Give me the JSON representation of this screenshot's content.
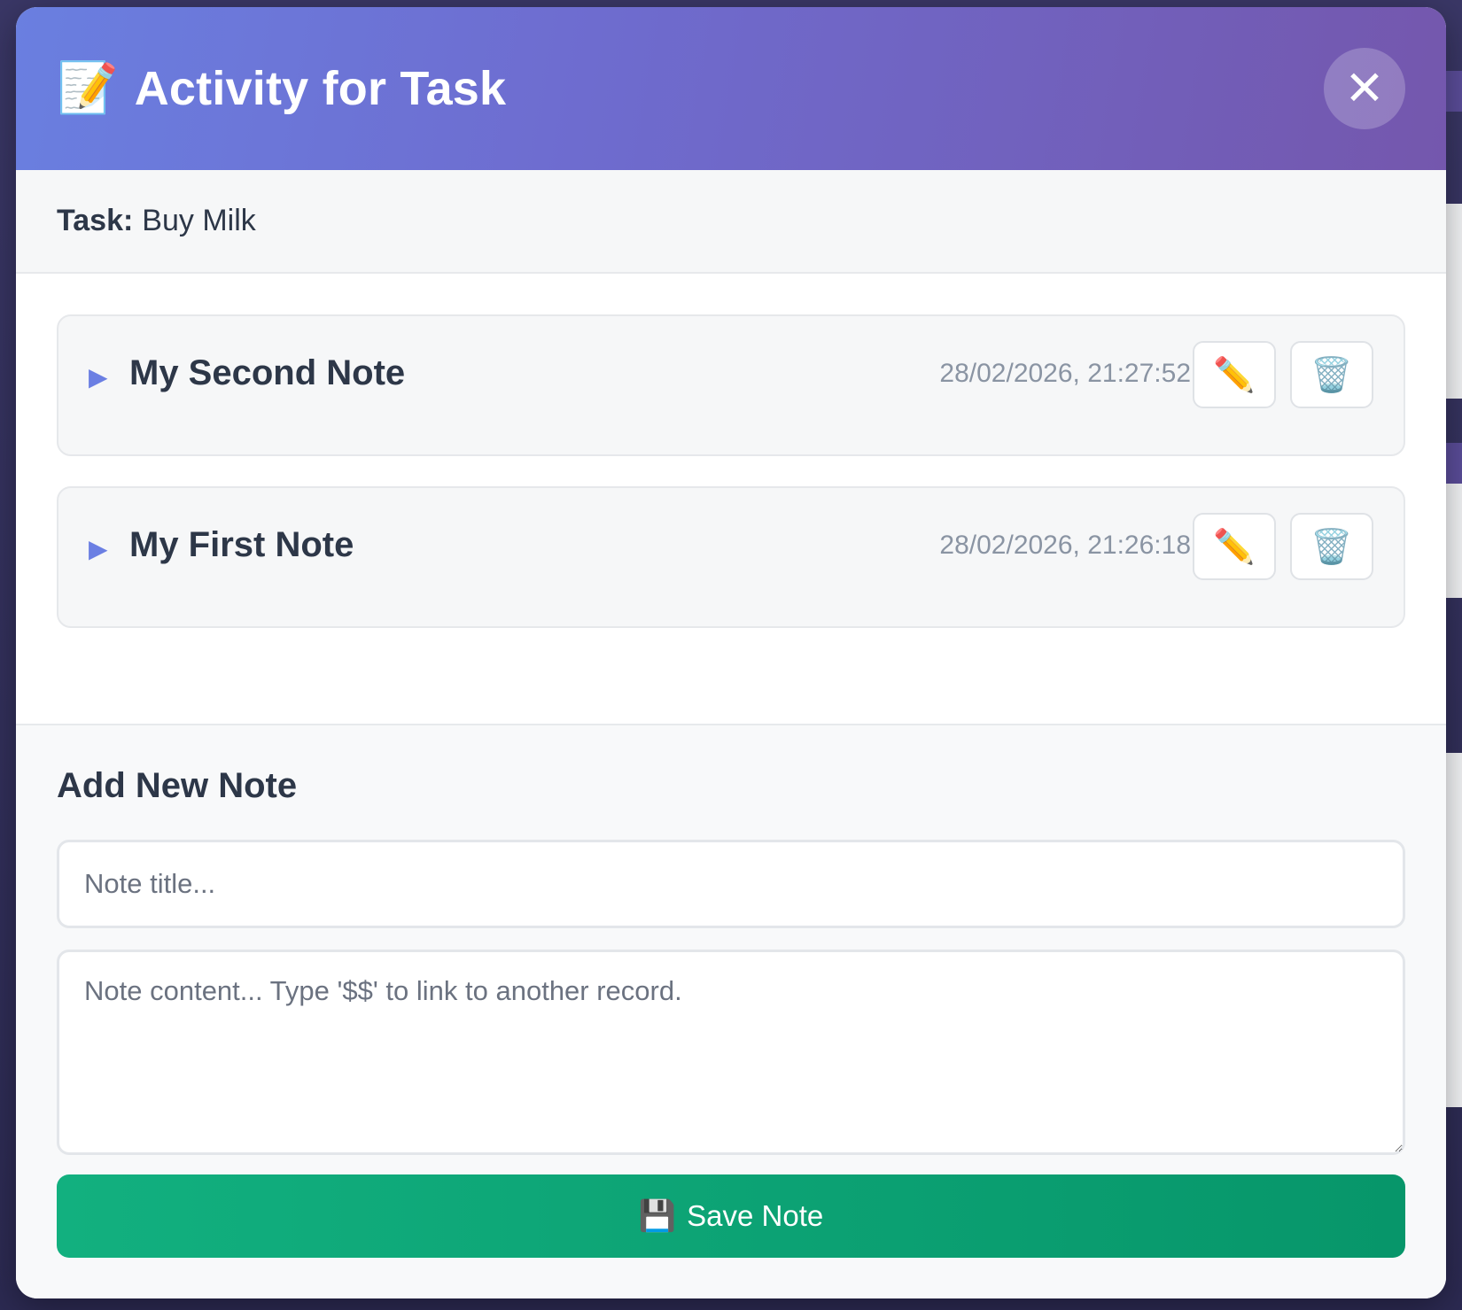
{
  "modal": {
    "title": "Activity for Task",
    "title_icon": "memo-icon",
    "close_label": "✕"
  },
  "task": {
    "label": "Task:",
    "name": "Buy Milk"
  },
  "notes": [
    {
      "title": "My Second Note",
      "timestamp": "28/02/2026, 21:27:52",
      "expand_icon": "▶",
      "edit_icon": "✏️",
      "delete_icon": "🗑️"
    },
    {
      "title": "My First Note",
      "timestamp": "28/02/2026, 21:26:18",
      "expand_icon": "▶",
      "edit_icon": "✏️",
      "delete_icon": "🗑️"
    }
  ],
  "add_note": {
    "heading": "Add New Note",
    "title_placeholder": "Note title...",
    "title_value": "",
    "content_placeholder": "Note content... Type '$$' to link to another record.",
    "content_value": "",
    "save_label": "Save Note",
    "save_icon": "💾"
  },
  "colors": {
    "header_gradient_start": "#6a7fe0",
    "header_gradient_end": "#7457ad",
    "save_gradient_start": "#12b07f",
    "save_gradient_end": "#07966a",
    "expand_arrow": "#6b7fe3"
  }
}
